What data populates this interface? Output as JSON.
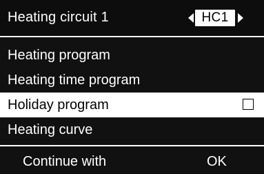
{
  "header": {
    "title": "Heating circuit 1",
    "circuit_selector": {
      "value": "HC1",
      "left_icon": "triangle-left-icon",
      "right_icon": "triangle-right-icon"
    }
  },
  "menu": {
    "items": [
      {
        "label": "Heating program",
        "selected": false
      },
      {
        "label": "Heating time program",
        "selected": false
      },
      {
        "label": "Holiday program",
        "selected": true,
        "checkbox_checked": false
      },
      {
        "label": "Heating curve",
        "selected": false
      }
    ]
  },
  "footer": {
    "left_label": "Continue with",
    "right_label": "OK"
  },
  "colors": {
    "background": "#111111",
    "foreground": "#ffffff",
    "selected_background": "#ffffff",
    "selected_text": "#000000"
  }
}
